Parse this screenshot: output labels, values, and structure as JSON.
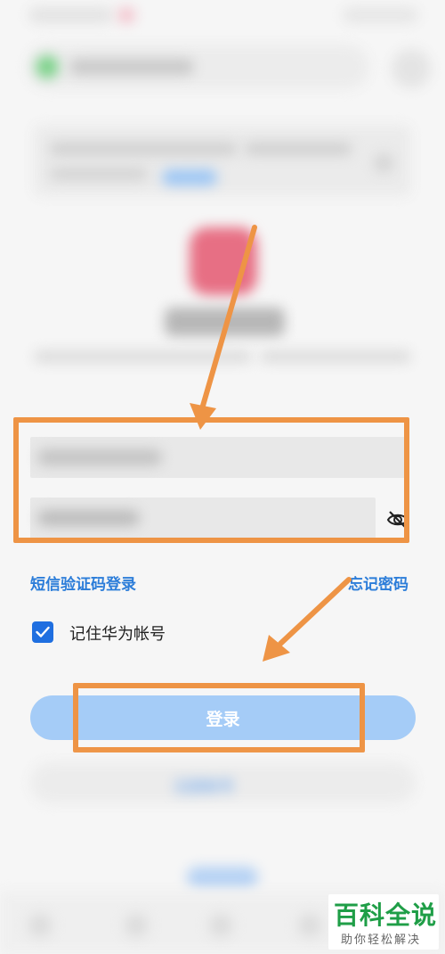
{
  "links": {
    "sms_login": "短信验证码登录",
    "forgot_password": "忘记密码"
  },
  "remember": {
    "label": "记住华为帐号",
    "checked": true
  },
  "buttons": {
    "login": "登录",
    "register": "注册帐号"
  },
  "watermark": {
    "title": "百科全说",
    "subtitle": "助你轻松解决"
  },
  "colors": {
    "accent": "#2c7dd9",
    "login_button": "#a5ccf7",
    "annotation": "#ee9445",
    "watermark_green": "#1f9e47"
  },
  "icons": {
    "password_toggle": "eye-off-icon",
    "checkbox": "check-icon"
  }
}
